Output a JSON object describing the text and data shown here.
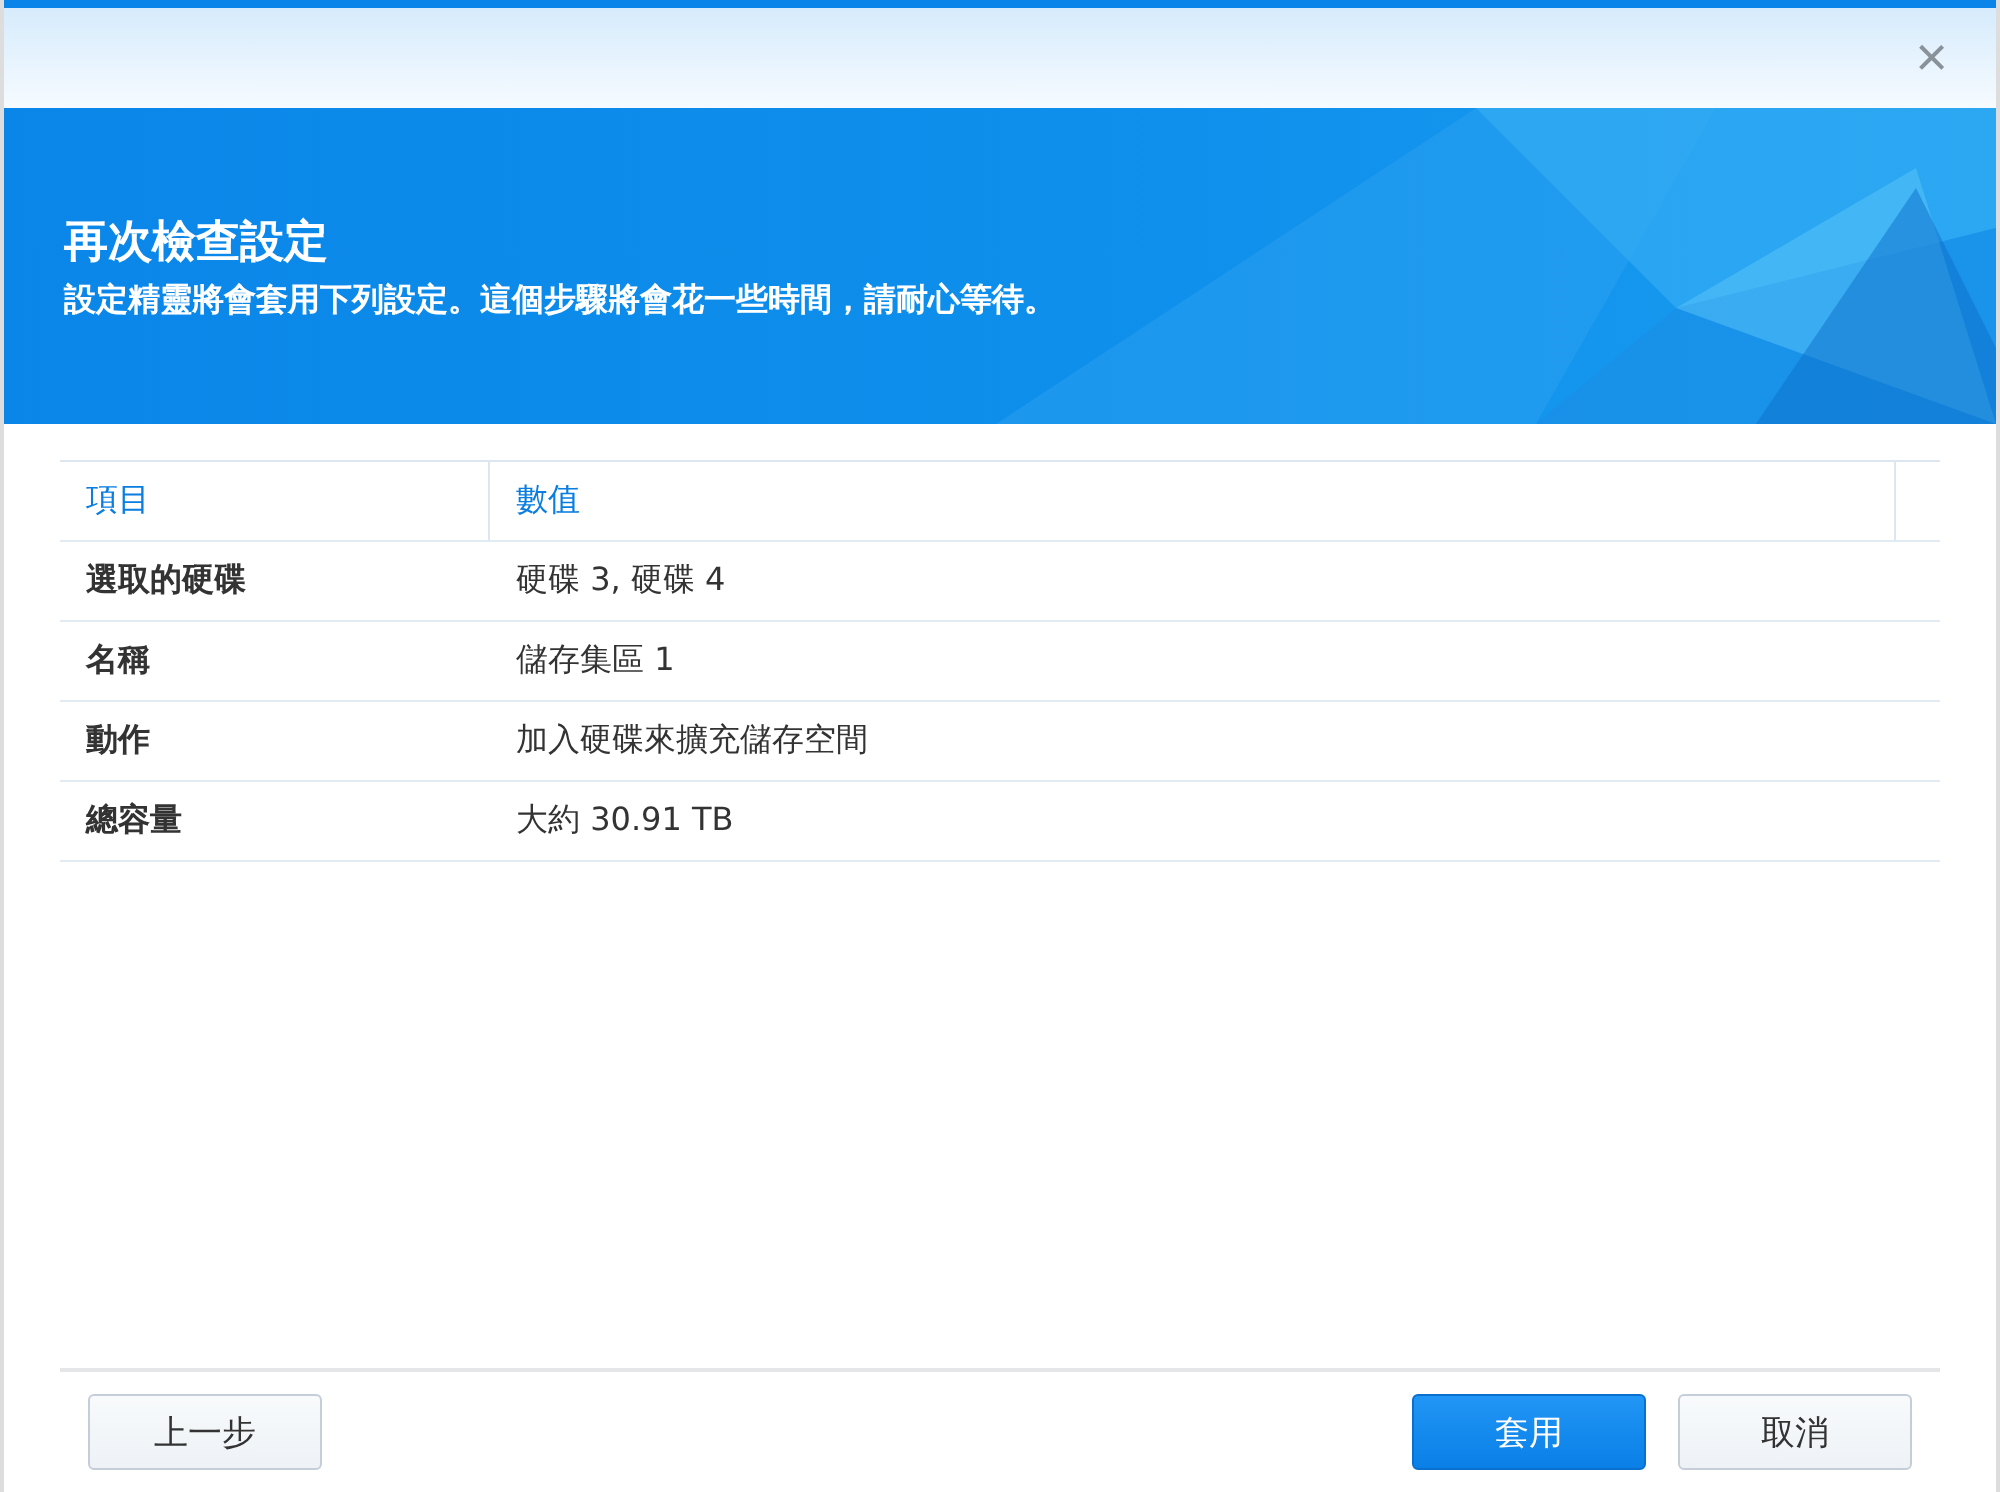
{
  "window": {
    "close": "×"
  },
  "header": {
    "title": "再次檢查設定",
    "subtitle": "設定精靈將會套用下列設定。這個步驟將會花一些時間，請耐心等待。"
  },
  "table": {
    "columns": [
      "項目",
      "數值"
    ],
    "rows": [
      [
        "選取的硬碟",
        "硬碟 3, 硬碟 4"
      ],
      [
        "名稱",
        "儲存集區 1"
      ],
      [
        "動作",
        "加入硬碟來擴充儲存空間"
      ],
      [
        "總容量",
        "大約 30.91 TB"
      ]
    ]
  },
  "buttons": [
    {
      "label": "上一步",
      "kind": "secondary"
    },
    {
      "label": "套用",
      "kind": "primary"
    },
    {
      "label": "取消",
      "kind": "secondary"
    }
  ]
}
